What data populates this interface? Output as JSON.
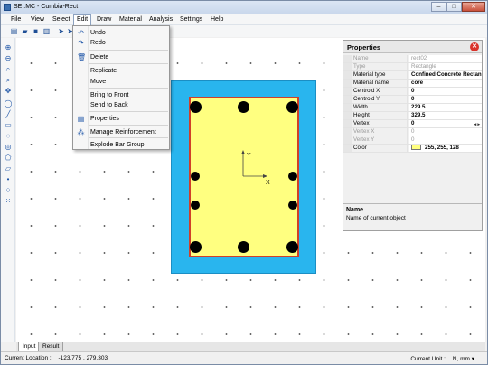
{
  "window": {
    "title": "SE::MC - Cumbia-Rect"
  },
  "menu": {
    "items": [
      "File",
      "View",
      "Select",
      "Edit",
      "Draw",
      "Material",
      "Analysis",
      "Settings",
      "Help"
    ],
    "active": "Edit"
  },
  "edit_menu": {
    "items": [
      {
        "label": "Undo",
        "icon": "undo-icon"
      },
      {
        "label": "Redo",
        "icon": "redo-icon"
      },
      {
        "label": "Delete",
        "icon": "delete-icon"
      },
      {
        "label": "Replicate",
        "icon": ""
      },
      {
        "label": "Move",
        "icon": ""
      },
      {
        "label": "Bring to Front",
        "icon": ""
      },
      {
        "label": "Send to Back",
        "icon": ""
      },
      {
        "label": "Properties",
        "icon": "properties-icon"
      },
      {
        "label": "Manage Reinforcement",
        "icon": "reinforcement-icon"
      },
      {
        "label": "Explode Bar Group",
        "icon": ""
      }
    ]
  },
  "canvas": {
    "axis_x_label": "X",
    "axis_y_label": "Y",
    "outer_color": "#29b5ee",
    "inner_color": "#ffff80",
    "inner_border_color": "#d0402a"
  },
  "properties": {
    "title": "Properties",
    "rows": [
      {
        "name": "Name",
        "value": "rect02",
        "state": "disabled"
      },
      {
        "name": "Type",
        "value": "Rectangle",
        "state": "disabled"
      },
      {
        "name": "Material type",
        "value": "Confined Concrete Rectan",
        "state": "bold"
      },
      {
        "name": "Material name",
        "value": "core",
        "state": "bold"
      },
      {
        "name": "Centroid  X",
        "value": "0",
        "state": "bold"
      },
      {
        "name": "Centroid  Y",
        "value": "0",
        "state": "bold"
      },
      {
        "name": "Width",
        "value": "229.5",
        "state": "bold"
      },
      {
        "name": "Height",
        "value": "329.5",
        "state": "bold"
      },
      {
        "name": "Vertex",
        "value": "0",
        "state": "bold"
      },
      {
        "name": "Vertex X",
        "value": "0",
        "state": "disabled"
      },
      {
        "name": "Vertex Y",
        "value": "0",
        "state": "disabled"
      },
      {
        "name": "Color",
        "value": "255, 255, 128",
        "state": "bold"
      }
    ],
    "desc_title": "Name",
    "desc_text": "Name of current object"
  },
  "tabs": {
    "input": "Input",
    "result": "Result"
  },
  "status": {
    "location_label": "Current Location :",
    "location_value": "-123.775 , 279.303",
    "unit_label": "Current Unit :",
    "unit_value": "N, mm",
    "unit_caret": "▾"
  }
}
